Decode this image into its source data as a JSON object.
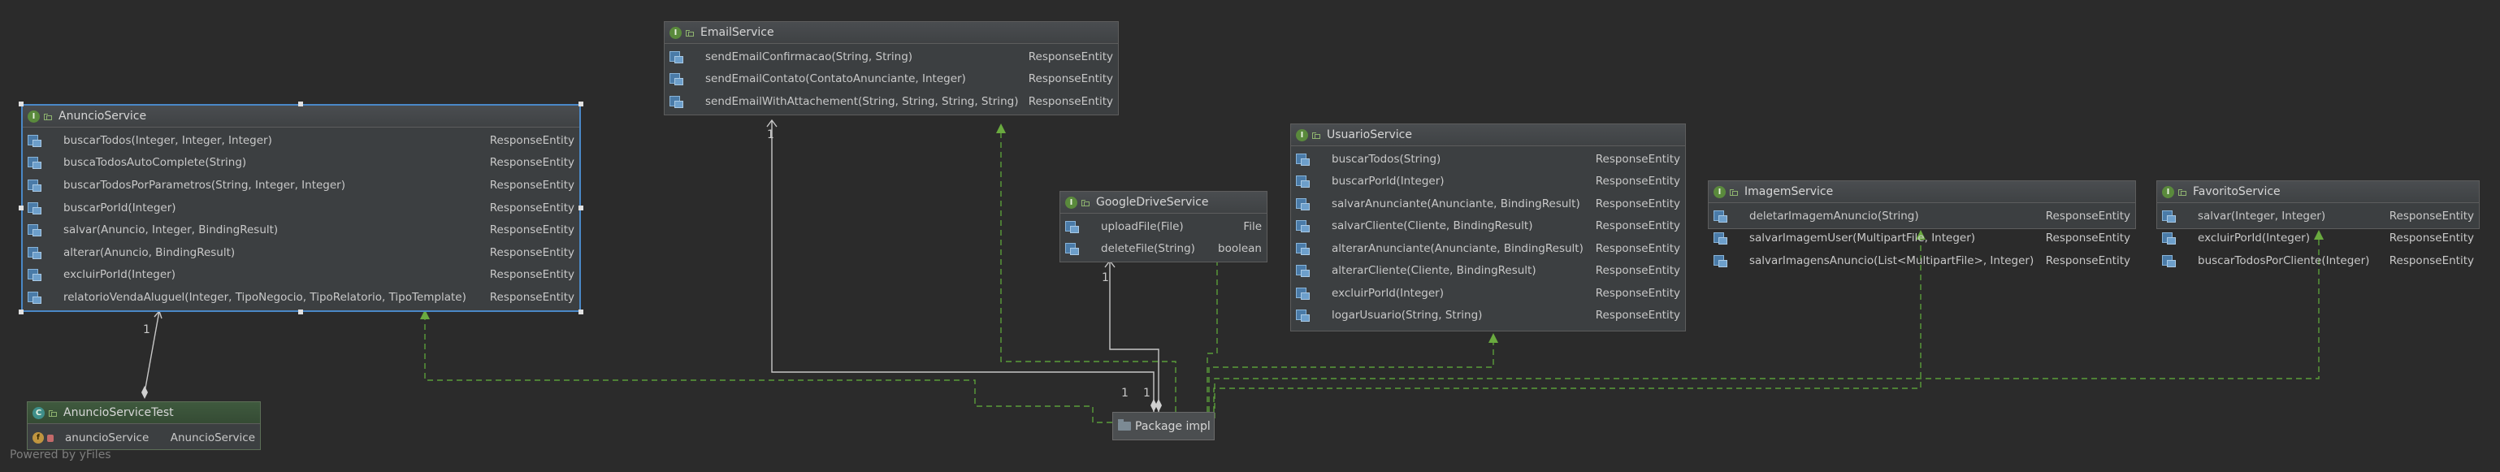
{
  "classes": {
    "anuncio": {
      "badge": "I",
      "name": "AnuncioService",
      "methods": [
        {
          "name": "buscarTodos(Integer, Integer, Integer)",
          "type": "ResponseEntity"
        },
        {
          "name": "buscaTodosAutoComplete(String)",
          "type": "ResponseEntity"
        },
        {
          "name": "buscarTodosPorParametros(String, Integer, Integer)",
          "type": "ResponseEntity"
        },
        {
          "name": "buscarPorId(Integer)",
          "type": "ResponseEntity"
        },
        {
          "name": "salvar(Anuncio, Integer, BindingResult)",
          "type": "ResponseEntity"
        },
        {
          "name": "alterar(Anuncio, BindingResult)",
          "type": "ResponseEntity"
        },
        {
          "name": "excluirPorId(Integer)",
          "type": "ResponseEntity"
        },
        {
          "name": "relatorioVendaAluguel(Integer, TipoNegocio, TipoRelatorio, TipoTemplate)",
          "type": "ResponseEntity"
        }
      ]
    },
    "email": {
      "badge": "I",
      "name": "EmailService",
      "methods": [
        {
          "name": "sendEmailConfirmacao(String, String)",
          "type": "ResponseEntity"
        },
        {
          "name": "sendEmailContato(ContatoAnunciante, Integer)",
          "type": "ResponseEntity"
        },
        {
          "name": "sendEmailWithAttachement(String, String, String, String)",
          "type": "ResponseEntity"
        }
      ]
    },
    "drive": {
      "badge": "I",
      "name": "GoogleDriveService",
      "methods": [
        {
          "name": "uploadFile(File)",
          "type": "File"
        },
        {
          "name": "deleteFile(String)",
          "type": "boolean"
        }
      ]
    },
    "usuario": {
      "badge": "I",
      "name": "UsuarioService",
      "methods": [
        {
          "name": "buscarTodos(String)",
          "type": "ResponseEntity"
        },
        {
          "name": "buscarPorId(Integer)",
          "type": "ResponseEntity"
        },
        {
          "name": "salvarAnunciante(Anunciante, BindingResult)",
          "type": "ResponseEntity"
        },
        {
          "name": "salvarCliente(Cliente, BindingResult)",
          "type": "ResponseEntity"
        },
        {
          "name": "alterarAnunciante(Anunciante, BindingResult)",
          "type": "ResponseEntity"
        },
        {
          "name": "alterarCliente(Cliente, BindingResult)",
          "type": "ResponseEntity"
        },
        {
          "name": "excluirPorId(Integer)",
          "type": "ResponseEntity"
        },
        {
          "name": "logarUsuario(String, String)",
          "type": "ResponseEntity"
        }
      ]
    },
    "imagem": {
      "badge": "I",
      "name": "ImagemService",
      "methods": [
        {
          "name": "deletarImagemAnuncio(String)",
          "type": "ResponseEntity"
        },
        {
          "name": "salvarImagemUser(MultipartFile, Integer)",
          "type": "ResponseEntity"
        },
        {
          "name": "salvarImagensAnuncio(List<MultipartFile>, Integer)",
          "type": "ResponseEntity"
        }
      ]
    },
    "favorito": {
      "badge": "I",
      "name": "FavoritoService",
      "methods": [
        {
          "name": "salvar(Integer, Integer)",
          "type": "ResponseEntity"
        },
        {
          "name": "excluirPorId(Integer)",
          "type": "ResponseEntity"
        },
        {
          "name": "buscarTodosPorCliente(Integer)",
          "type": "ResponseEntity"
        }
      ]
    },
    "test": {
      "badge": "C",
      "name": "AnuncioServiceTest",
      "field_badge": "f",
      "field_name": "anuncioService",
      "field_type": "AnuncioService"
    }
  },
  "package_node": {
    "label": "Package impl",
    "icon": "folder-icon"
  },
  "multiplicities": {
    "test_to_anuncio": "1",
    "pkg_to_email": "1",
    "pkg_to_drive": "1",
    "pkg_side_a": "1",
    "pkg_side_b": "1"
  },
  "footer": "Powered by yFiles",
  "colors": {
    "background": "#2b2b2b",
    "node": "#3c3f41",
    "implements_edge": "#5a9e3a",
    "association_edge": "#c8c8c8",
    "selection": "#4a88c7"
  }
}
